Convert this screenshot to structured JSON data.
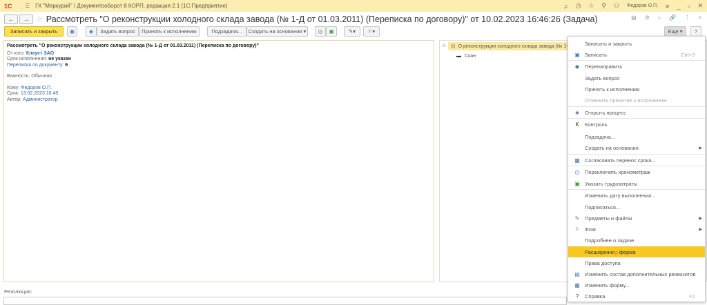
{
  "app": {
    "logo": "1С",
    "title": "ГК \"Меркурий\" / Документооборот 8 КОРП, редакция 2.1  (1С:Предприятие)",
    "user": "Федоров О.П."
  },
  "form": {
    "title": "Рассмотреть \"О реконструкции холодного склада завода (№ 1-Д от 01.03.2011) (Переписка по договору)\" от 10.02.2023 16:46:26 (Задача)"
  },
  "toolbar": {
    "save_close": "Записать и закрыть",
    "ask": "Задать вопрос",
    "accept": "Принять к исполнению",
    "subtask": "Подзадача...",
    "create_based": "Создать на основании",
    "more": "Еще",
    "help": "?"
  },
  "task": {
    "heading": "Рассмотреть \"О реконструкции холодного склада завода (№ 1-Д от 01.03.2011) (Переписка по договору)\"",
    "from_label": "От кого:",
    "from": "Клауст ЗАО",
    "deadline_label": "Срок исполнения:",
    "deadline": "не указан",
    "corr_label": "Переписка по документу:",
    "corr": "6",
    "importance": "Важность: Обычная",
    "to_label": "Кому:",
    "to": "Федоров О.П.",
    "due_label": "Срок:",
    "due": "13.02.2023 16:45",
    "author_label": "Автор:",
    "author": "Администратор"
  },
  "tree": {
    "root": "О реконструкции холодного склада завода (№ 1-Д",
    "child": "Скан"
  },
  "resolution_label": "Резолюция:",
  "menu": [
    {
      "label": "Записать и закрыть",
      "icon": ""
    },
    {
      "label": "Записать",
      "icon": "save-icon",
      "key": "Ctrl+S"
    },
    {
      "label": "Перенаправить",
      "icon": "redirect-icon"
    },
    {
      "label": "Задать вопрос",
      "icon": ""
    },
    {
      "label": "Принять к исполнению",
      "icon": ""
    },
    {
      "label": "Отменить принятие к исполнению",
      "icon": "",
      "disabled": true
    },
    {
      "label": "Открыть процесс",
      "icon": "process-icon"
    },
    {
      "label": "Контроль",
      "icon": "control-icon"
    },
    {
      "label": "Подзадача...",
      "icon": ""
    },
    {
      "label": "Создать на основании",
      "icon": "",
      "submenu": true
    },
    {
      "label": "Согласовать перенос срока...",
      "icon": "calendar-icon"
    },
    {
      "label": "Переключить хронометраж",
      "icon": "clock-icon"
    },
    {
      "label": "Указать трудозатраты",
      "icon": "labor-icon"
    },
    {
      "label": "Изменить дату выполнения...",
      "icon": ""
    },
    {
      "label": "Подписаться...",
      "icon": ""
    },
    {
      "label": "Предметы и файлы",
      "icon": "paperclip-icon",
      "submenu": true
    },
    {
      "label": "Флаг",
      "icon": "flag-icon",
      "submenu": true
    },
    {
      "label": "Подробнее о задаче",
      "icon": ""
    },
    {
      "label": "Расширенная форма",
      "icon": "",
      "highlighted": true
    },
    {
      "label": "Права доступа",
      "icon": ""
    },
    {
      "label": "Изменить состав дополнительных реквизитов",
      "icon": "attributes-icon"
    },
    {
      "label": "Изменить форму...",
      "icon": "form-icon"
    },
    {
      "label": "Справка",
      "icon": "help-icon",
      "key": "F1"
    }
  ]
}
